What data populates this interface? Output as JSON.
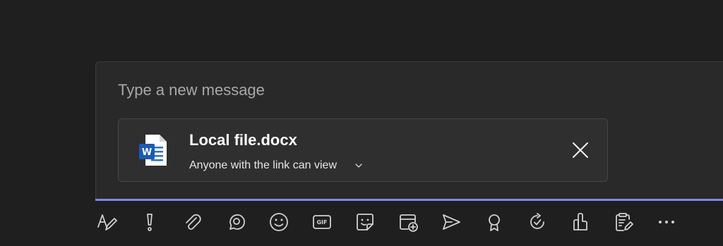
{
  "compose": {
    "placeholder": "Type a new message"
  },
  "attachment": {
    "file_name": "Local file.docx",
    "permission_label": "Anyone with the link can view",
    "file_icon": "word-doc-icon",
    "close_icon": "close-icon"
  },
  "toolbar": {
    "items": [
      {
        "icon": "format-icon"
      },
      {
        "icon": "important-icon"
      },
      {
        "icon": "attach-icon"
      },
      {
        "icon": "loop-icon"
      },
      {
        "icon": "emoji-icon"
      },
      {
        "icon": "gif-icon",
        "label": "GIF"
      },
      {
        "icon": "sticker-icon"
      },
      {
        "icon": "schedule-meeting-icon"
      },
      {
        "icon": "stream-icon"
      },
      {
        "icon": "praise-icon"
      },
      {
        "icon": "update-icon"
      },
      {
        "icon": "approvals-icon"
      },
      {
        "icon": "forms-icon"
      },
      {
        "icon": "more-icon"
      }
    ]
  },
  "colors": {
    "background": "#1f1f1f",
    "compose_bg": "#292929",
    "accent": "#7f85f5",
    "word_blue": "#185abd"
  }
}
